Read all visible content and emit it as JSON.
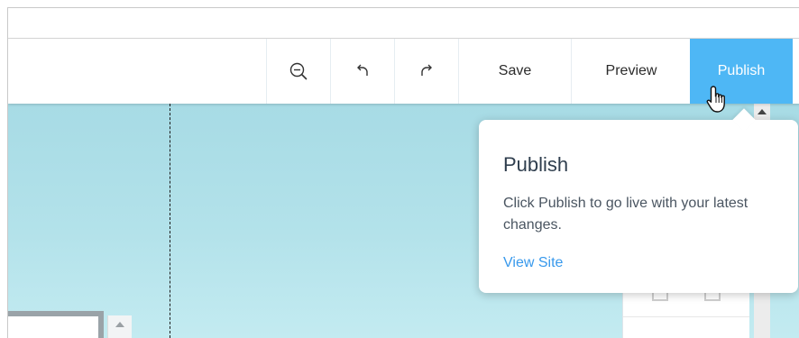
{
  "toolbar": {
    "zoom_out_icon": "zoom-out-icon",
    "undo_icon": "undo-icon",
    "redo_icon": "redo-icon",
    "save_label": "Save",
    "preview_label": "Preview",
    "publish_label": "Publish"
  },
  "tooltip": {
    "title": "Publish",
    "body": "Click Publish to go live with your latest changes.",
    "link": "View Site"
  },
  "colors": {
    "publish_button": "#4eb7f5",
    "link": "#3899ec",
    "canvas_background": "#b3e2ea"
  },
  "cursor_icon": "hand-pointer-icon"
}
